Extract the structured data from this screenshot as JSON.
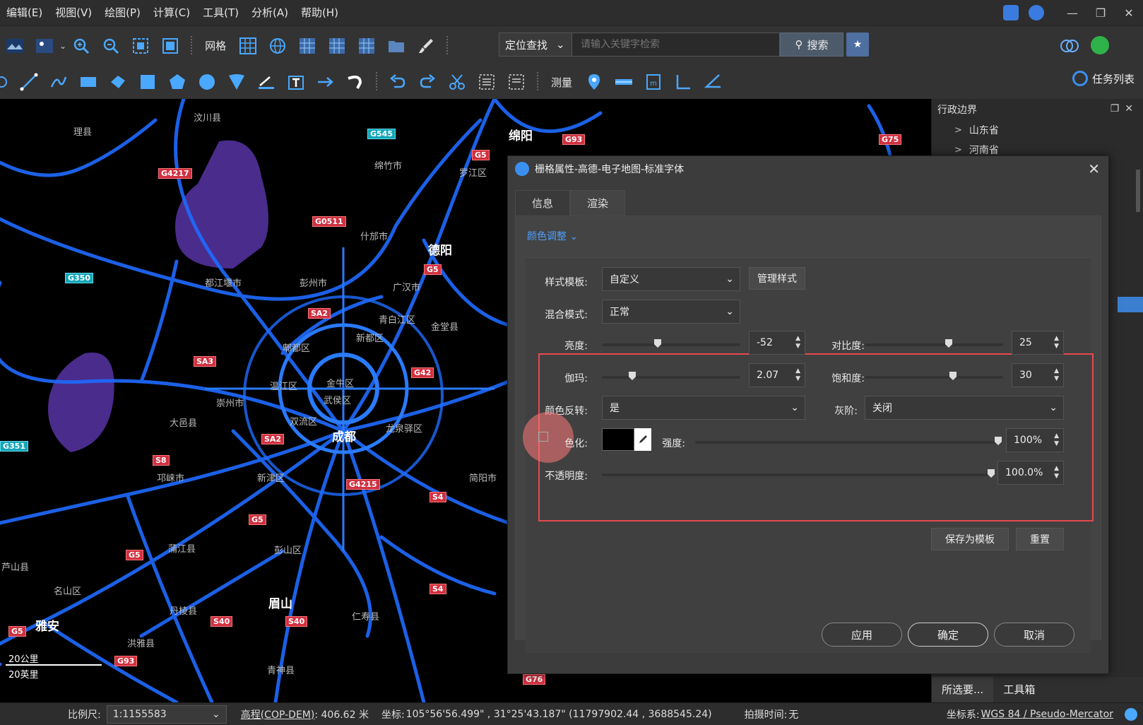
{
  "menu": [
    "编辑(E)",
    "视图(V)",
    "绘图(P)",
    "计算(C)",
    "工具(T)",
    "分析(A)",
    "帮助(H)"
  ],
  "toolbar1": {
    "grid_label": "网格"
  },
  "search": {
    "locate_label": "定位查找",
    "placeholder": "请输入关键字检索",
    "button": "搜索"
  },
  "toolbar2": {
    "measure_label": "测量",
    "task_list": "任务列表"
  },
  "map": {
    "counties": [
      "汶川县",
      "理县",
      "绵竹市",
      "什邡市",
      "罗江区",
      "都江堰市",
      "彭州市",
      "广汉市",
      "青白江区",
      "金堂县",
      "新都区",
      "郫都区",
      "温江区",
      "崇州市",
      "金牛区",
      "武侯区",
      "双流区",
      "龙泉驿区",
      "大邑县",
      "邛崃市",
      "新津区",
      "彭山区",
      "蒲江县",
      "芦山县",
      "名山区",
      "丹棱县",
      "仁寿县",
      "洪雅县",
      "青神县",
      "简阳市"
    ],
    "cities": [
      "绵阳",
      "德阳",
      "成都",
      "眉山",
      "雅安"
    ],
    "shields_red": [
      "G4217",
      "G93",
      "G5",
      "G0511",
      "G75",
      "G5",
      "SA2",
      "SA3",
      "G42",
      "SA2",
      "S8",
      "G4215",
      "S4",
      "G5",
      "G5",
      "S4",
      "S40",
      "S40",
      "G5",
      "G93",
      "G76"
    ],
    "shields_cyan": [
      "G545",
      "G350",
      "G351"
    ],
    "scalebar": {
      "km": "20公里",
      "mi": "20英里"
    }
  },
  "right_panel": {
    "title": "行政边界",
    "items": [
      "山东省",
      "河南省"
    ],
    "bottom_tabs": [
      "所选要...",
      "工具箱"
    ]
  },
  "dialog": {
    "title": "栅格属性-高德-电子地图-标准字体",
    "tabs": [
      "信息",
      "渲染"
    ],
    "section": "颜色调整",
    "style_template_label": "样式模板:",
    "style_template_value": "自定义",
    "manage_style": "管理样式",
    "blend_mode_label": "混合模式:",
    "blend_mode_value": "正常",
    "brightness_label": "亮度:",
    "brightness": -52,
    "contrast_label": "对比度:",
    "contrast": 25,
    "gamma_label": "伽玛:",
    "gamma": "2.07",
    "saturation_label": "饱和度:",
    "saturation": 30,
    "invert_label": "颜色反转:",
    "invert_value": "是",
    "grayscale_label": "灰阶:",
    "grayscale_value": "关闭",
    "colorize_label": "色化:",
    "strength_label": "强度:",
    "strength": "100%",
    "opacity_label": "不透明度:",
    "opacity": "100.0%",
    "save_template": "保存为模板",
    "reset": "重置",
    "apply": "应用",
    "ok": "确定",
    "cancel": "取消"
  },
  "status": {
    "scale_label": "比例尺:",
    "scale_value": "1:1155583",
    "elevation_label": "高程(COP-DEM)",
    "elevation_value": ": 406.62 米",
    "coord_label": "坐标:",
    "coord_value": "105°56'56.499\" , 31°25'43.187\"  (11797902.44 , 3688545.24)",
    "capture_label": "拍摄时间:",
    "capture_value": "无",
    "crs_label": "坐标系:",
    "crs_value": "WGS 84 / Pseudo-Mercator"
  },
  "colors": {
    "accent": "#4ea0ff",
    "highlight": "#e8484e",
    "road": "#1e6bff",
    "region": "#4a2c8c"
  }
}
